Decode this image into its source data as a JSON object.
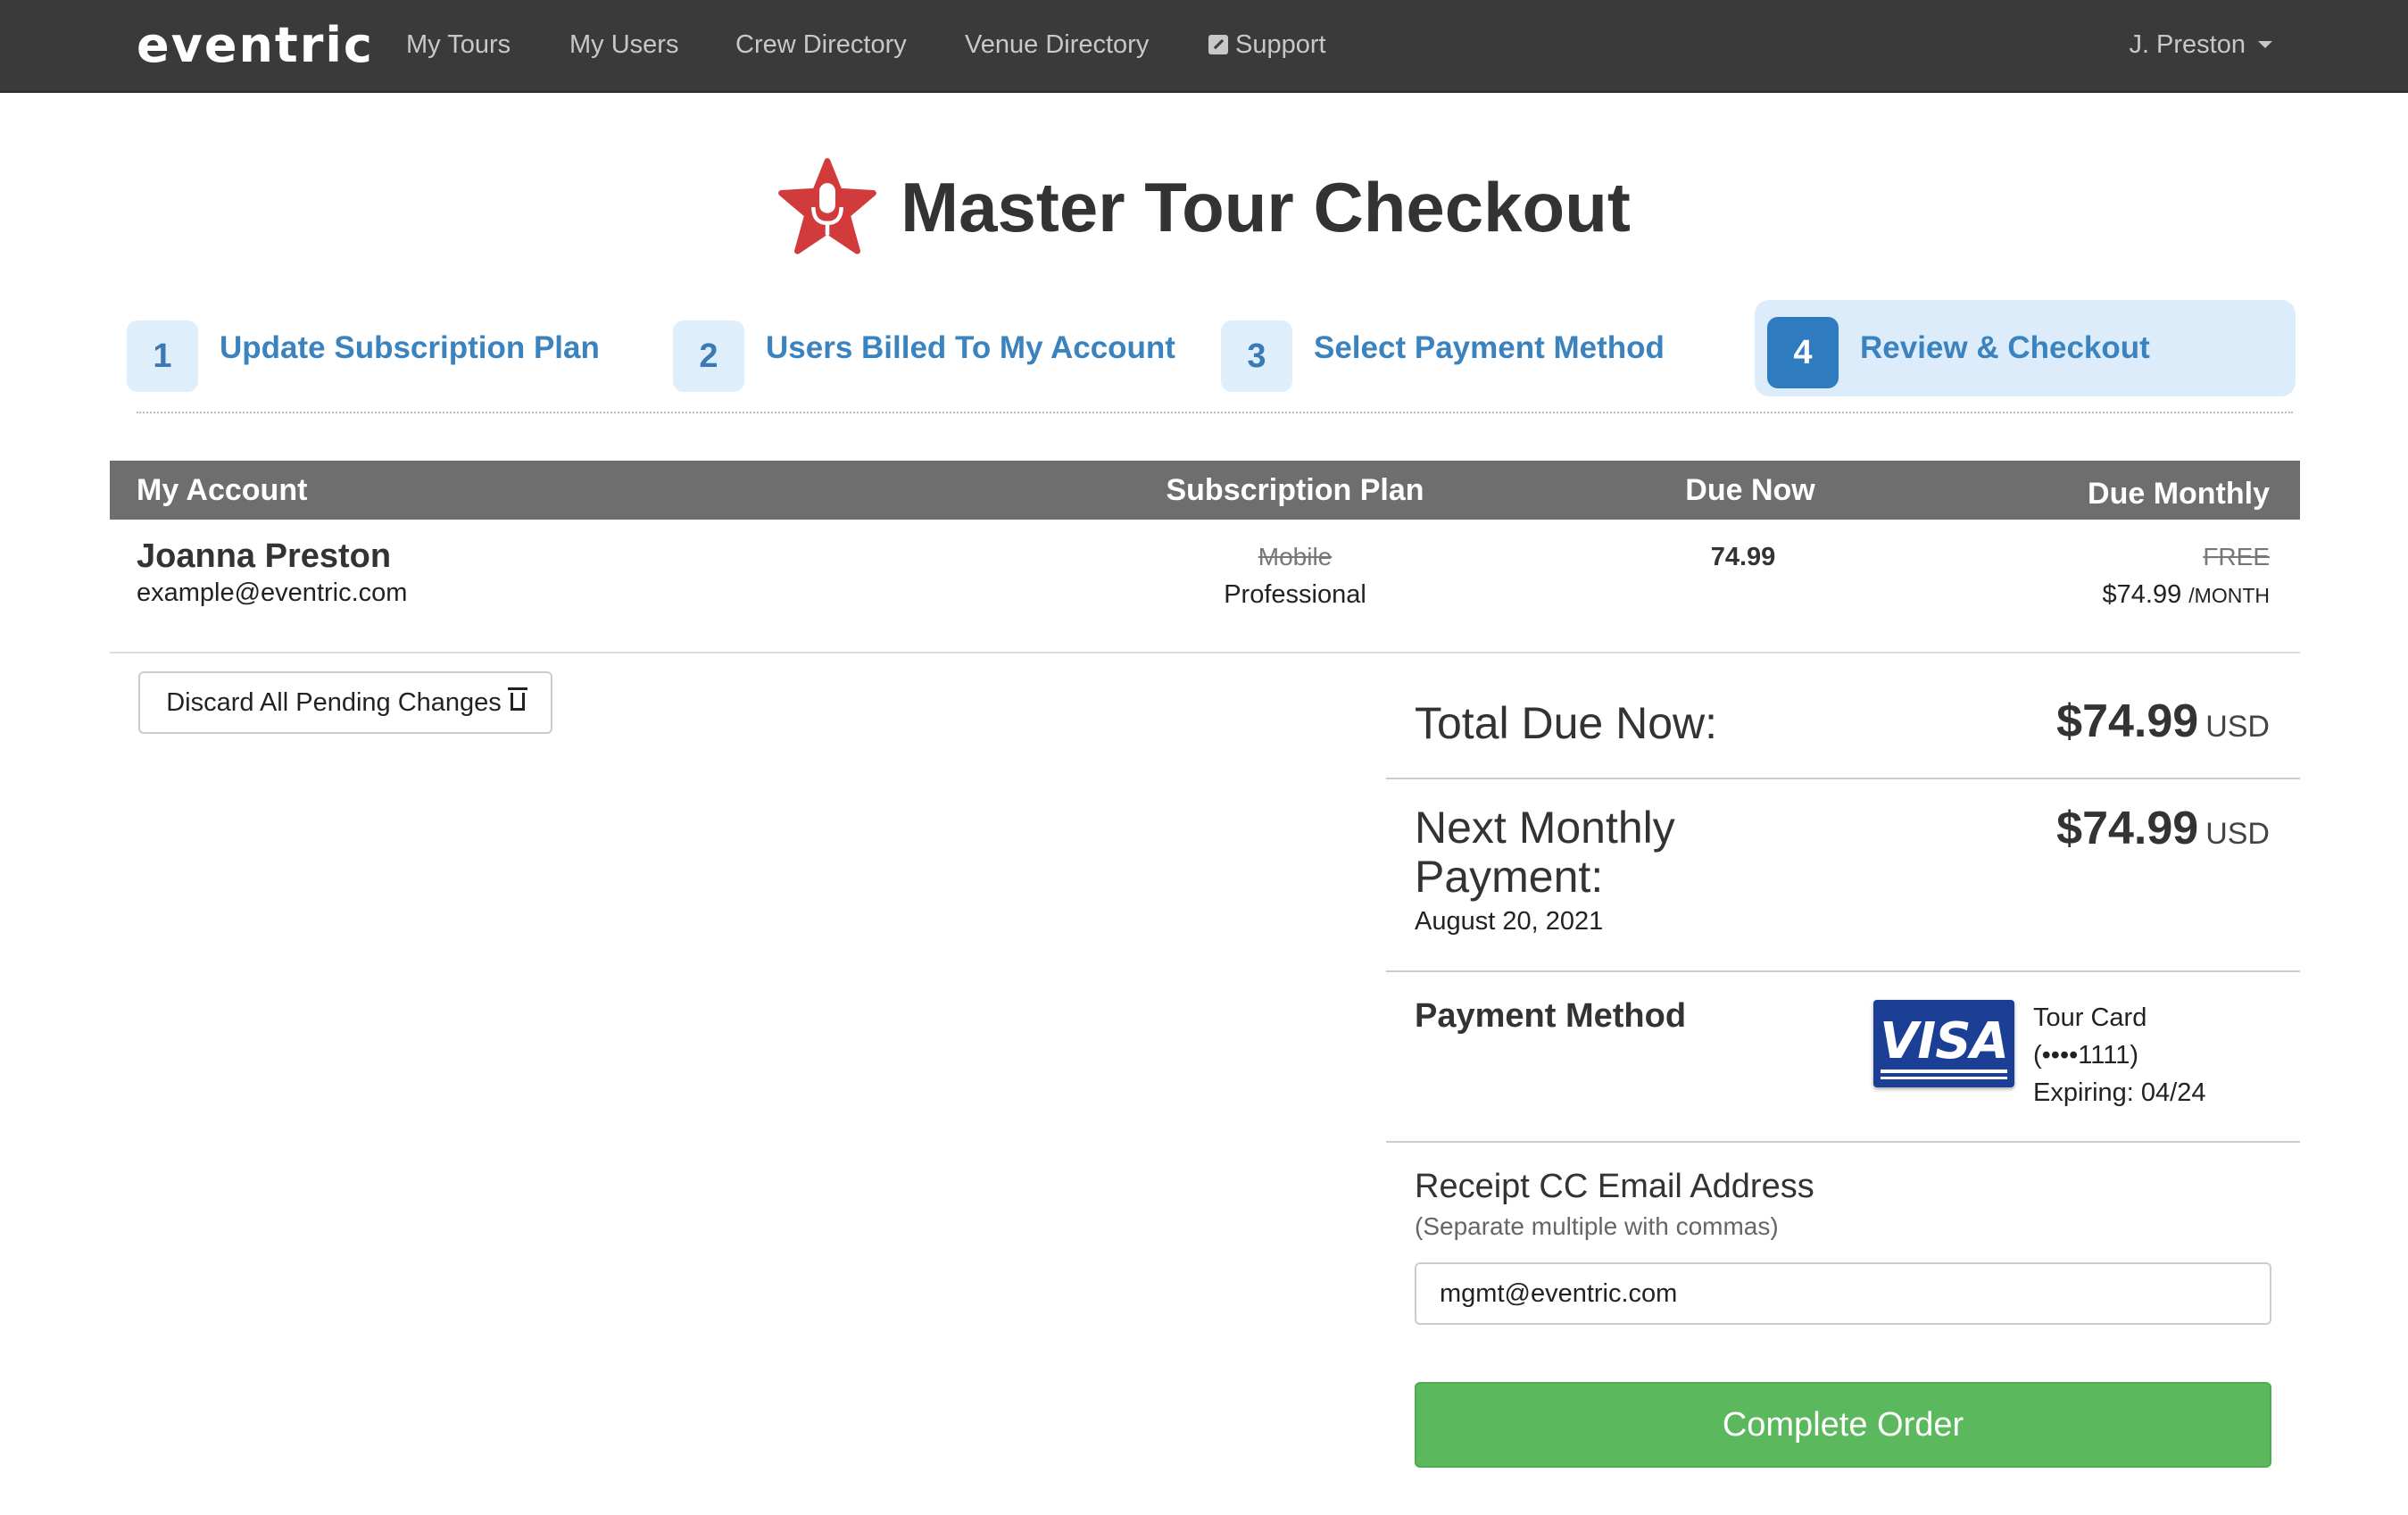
{
  "nav": {
    "logo": "eventric",
    "links": [
      "My Tours",
      "My Users",
      "Crew Directory",
      "Venue Directory",
      "Support"
    ],
    "user": "J. Preston"
  },
  "title": "Master Tour Checkout",
  "steps": [
    {
      "num": "1",
      "label": "Update Subscription Plan"
    },
    {
      "num": "2",
      "label": "Users Billed To My Account"
    },
    {
      "num": "3",
      "label": "Select Payment Method"
    },
    {
      "num": "4",
      "label": "Review & Checkout"
    }
  ],
  "table": {
    "headers": [
      "My Account",
      "Subscription Plan",
      "Due Now",
      "Due Monthly"
    ],
    "row": {
      "name": "Joanna Preston",
      "email": "example@eventric.com",
      "old_plan": "Mobile",
      "new_plan": "Professional",
      "due_now": "74.99",
      "old_monthly": "FREE",
      "new_monthly": "$74.99",
      "per_month": "/MONTH"
    }
  },
  "discard_label": "Discard All Pending Changes",
  "summary": {
    "total_label": "Total Due Now:",
    "total_value": "$74.99",
    "currency": "USD",
    "next_label_line1": "Next Monthly",
    "next_label_line2": "Payment:",
    "next_value": "$74.99",
    "next_date": "August 20, 2021",
    "payment_method_label": "Payment Method",
    "card_brand": "VISA",
    "card_name": "Tour Card",
    "card_number": "(••••1111)",
    "card_expiry": "Expiring: 04/24",
    "receipt_label": "Receipt CC Email Address",
    "receipt_hint": "(Separate multiple with commas)",
    "receipt_value": "mgmt@eventric.com",
    "complete_label": "Complete Order"
  },
  "colors": {
    "nav_bg": "#3a3a3a",
    "step_blue": "#3a83be",
    "step_active": "#2f7bbf",
    "table_header": "#6e6e6e",
    "success_green": "#5cb85c",
    "visa_blue": "#1a3f95",
    "star_red": "#d13b3b"
  }
}
